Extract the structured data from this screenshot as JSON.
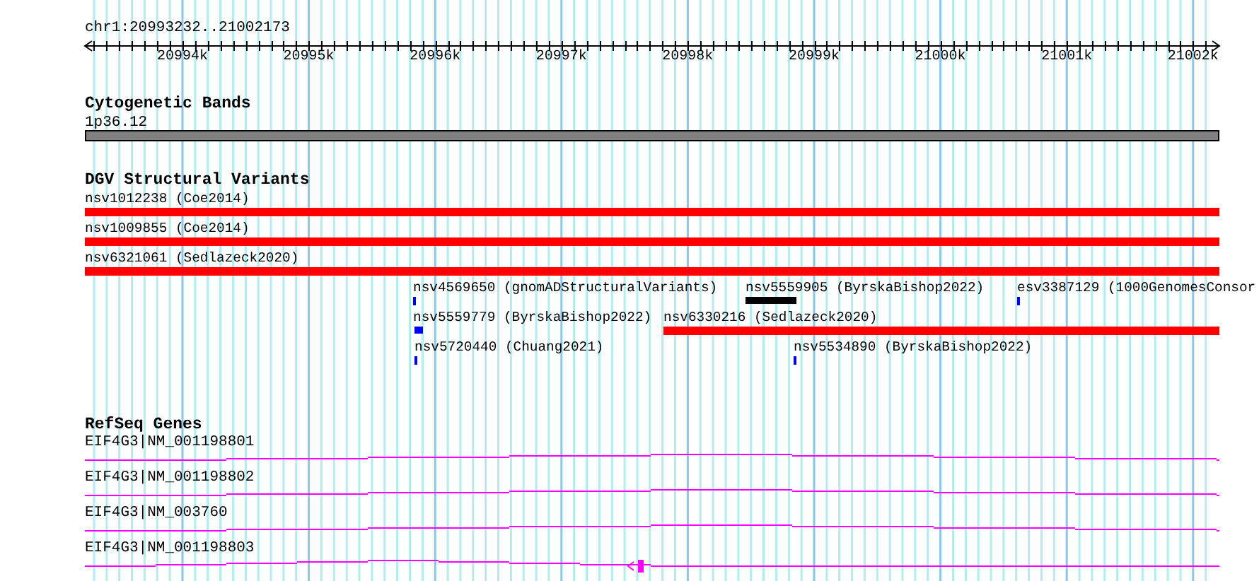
{
  "ruler": {
    "location": "chr1:20993232..21002173",
    "ticks": [
      "20994k",
      "20995k",
      "20996k",
      "20997k",
      "20998k",
      "20999k",
      "21000k",
      "21001k",
      "21002k"
    ]
  },
  "tracks": [
    {
      "kind": "cytoband",
      "title": "Cytogenetic Bands",
      "features": [
        {
          "label": "1p36.12",
          "color": "#808080"
        }
      ]
    },
    {
      "kind": "variants",
      "title": "DGV Structural Variants",
      "features": [
        {
          "label": "nsv1012238 (Coe2014)",
          "color": "#ff0000"
        },
        {
          "label": "nsv1009855 (Coe2014)",
          "color": "#ff0000"
        },
        {
          "label": "nsv6321061 (Sedlazeck2020)",
          "color": "#ff0000"
        },
        {
          "label": "nsv4569650 (gnomADStructuralVariants)",
          "color": "#0000ff"
        },
        {
          "label": "nsv5559905 (ByrskaBishop2022)",
          "color": "#000000"
        },
        {
          "label": "esv3387129 (1000GenomesConsor",
          "color": "#0000ff"
        },
        {
          "label": "nsv5559779 (ByrskaBishop2022)",
          "color": "#0000ff"
        },
        {
          "label": "nsv6330216 (Sedlazeck2020)",
          "color": "#ff0000"
        },
        {
          "label": "nsv5720440 (Chuang2021)",
          "color": "#0000ff"
        },
        {
          "label": "nsv5534890 (ByrskaBishop2022)",
          "color": "#0000ff"
        }
      ]
    },
    {
      "kind": "genes",
      "title": "RefSeq Genes",
      "features": [
        {
          "label": "EIF4G3|NM_001198801"
        },
        {
          "label": "EIF4G3|NM_001198802"
        },
        {
          "label": "EIF4G3|NM_003760"
        },
        {
          "label": "EIF4G3|NM_001198803"
        }
      ]
    }
  ]
}
